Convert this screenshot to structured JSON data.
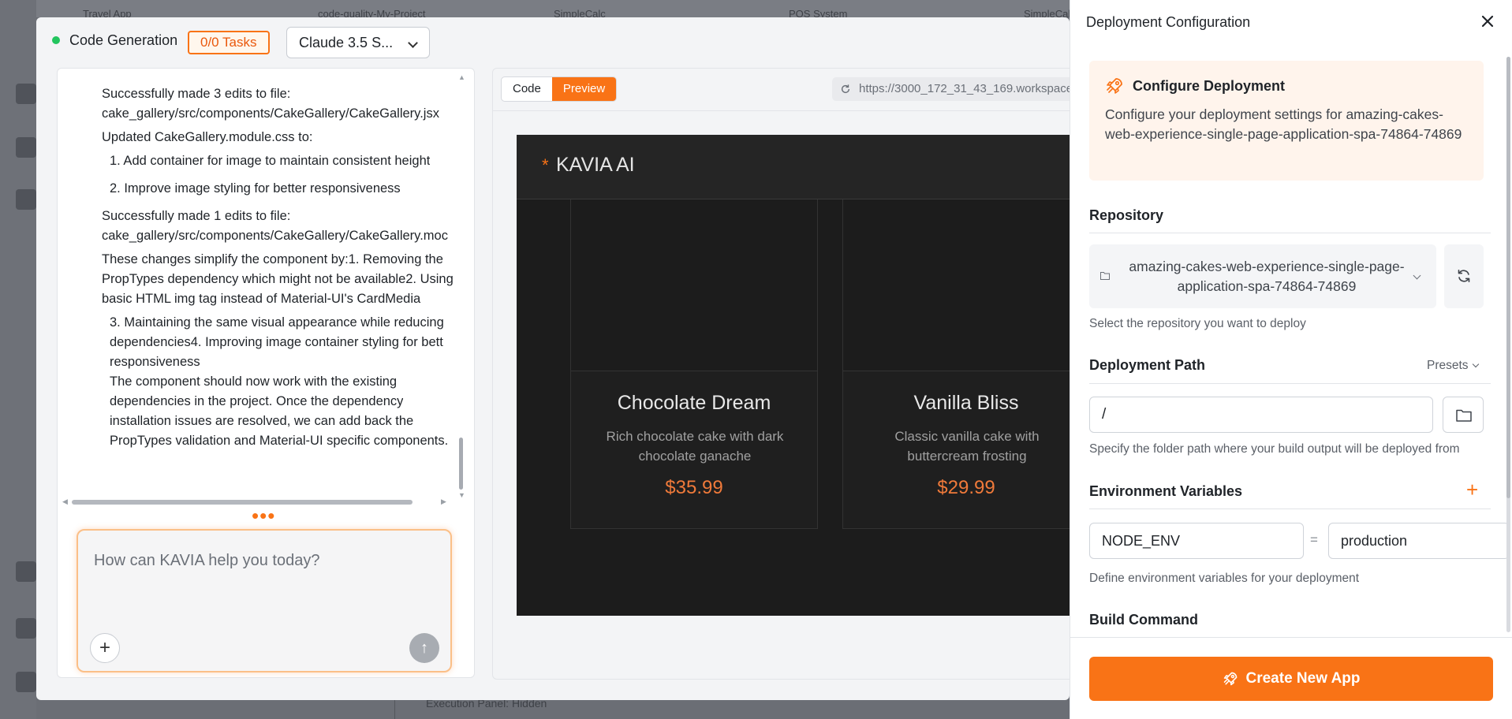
{
  "background": {
    "tabs": [
      "Travel App",
      "code-quality-My-Project",
      "SimpleCalc",
      "POS System",
      "SimpleCalc"
    ],
    "execution_panel": "Execution Panel: Hidden"
  },
  "header": {
    "title": "Code Generation",
    "tasks_badge": "0/0 Tasks",
    "model": "Claude 3.5 S..."
  },
  "chat": {
    "messages": [
      "Successfully made 3 edits to file:",
      "cake_gallery/src/components/CakeGallery/CakeGallery.jsx",
      "Updated CakeGallery.module.css to:",
      "1. Add container for image to maintain consistent height",
      "2. Improve image styling for better responsiveness",
      "Successfully made 1 edits to file:",
      "cake_gallery/src/components/CakeGallery/CakeGallery.moc",
      "These changes simplify the component by:1. Removing the",
      "PropTypes dependency which might not be available2. Using",
      "basic HTML img tag instead of Material-UI's CardMedia",
      "3. Maintaining the same visual appearance while reducing",
      "dependencies4. Improving image container styling for bett",
      "responsiveness",
      "The component should now work with the existing",
      "dependencies in the project. Once the dependency",
      "installation issues are resolved, we can add back the",
      "PropTypes validation and Material-UI specific components."
    ],
    "input_placeholder": "How can KAVIA help you today?"
  },
  "preview": {
    "tabs": [
      "Code",
      "Preview"
    ],
    "active_tab": "Preview",
    "url": "https://3000_172_31_43_169.workspace",
    "app": {
      "logo": "KAVIA AI",
      "cakes": [
        {
          "name": "Chocolate Dream",
          "description": "Rich chocolate cake with dark chocolate ganache",
          "price": "$35.99"
        },
        {
          "name": "Vanilla Bliss",
          "description": "Classic vanilla cake with buttercream frosting",
          "price": "$29.99"
        }
      ]
    }
  },
  "deploy": {
    "title": "Deployment Configuration",
    "configure_title": "Configure Deployment",
    "configure_desc": "Configure your deployment settings for amazing-cakes-web-experience-single-page-application-spa-74864-74869",
    "repository": {
      "title": "Repository",
      "value": "amazing-cakes-web-experience-single-page-application-spa-74864-74869",
      "help": "Select the repository you want to deploy"
    },
    "path": {
      "title": "Deployment Path",
      "presets": "Presets",
      "value": "/",
      "help": "Specify the folder path where your build output will be deployed from"
    },
    "env": {
      "title": "Environment Variables",
      "key": "NODE_ENV",
      "equals": "=",
      "value": "production",
      "help": "Define environment variables for your deployment"
    },
    "build": {
      "title": "Build Command"
    },
    "create_button": "Create New App"
  },
  "colors": {
    "accent": "#f97316",
    "status": "#22c55e"
  }
}
